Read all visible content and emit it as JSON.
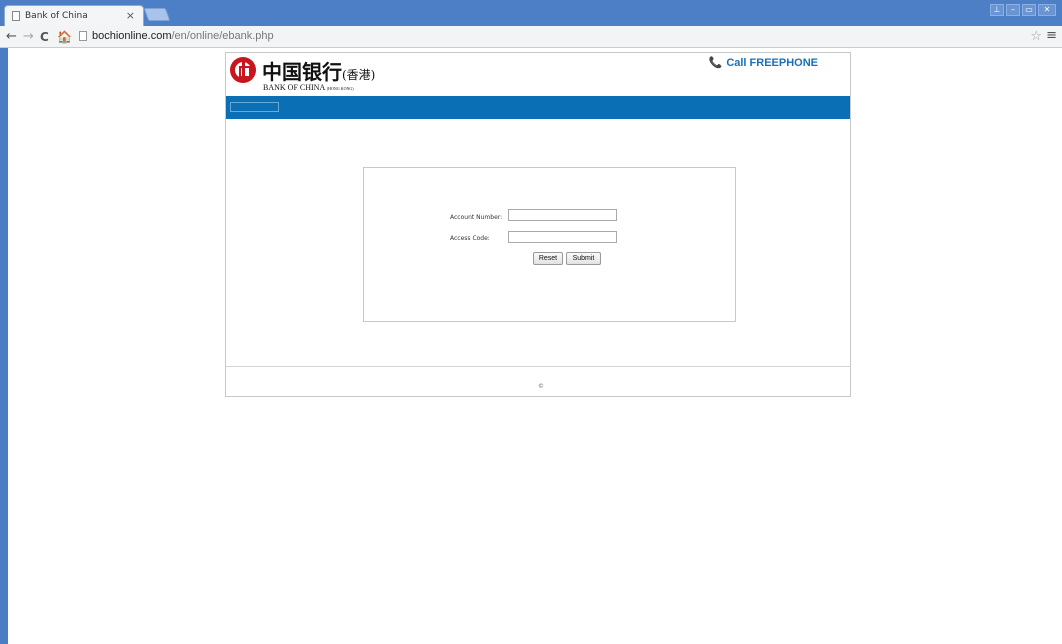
{
  "browser": {
    "tab_title": "Bank of China",
    "tab_close": "×",
    "url_domain": "bochionline.com",
    "url_path": "/en/online/ebank.php",
    "back": "←",
    "forward": "→",
    "reload": "C",
    "home": "🏠",
    "star": "☆",
    "menu": "≡",
    "win_user": "⊥",
    "win_min": "–",
    "win_max": "▭",
    "win_close": "✕"
  },
  "header": {
    "logo_cn": "中国银行",
    "logo_cn_sub": "(香港)",
    "logo_en": "BANK OF CHINA",
    "logo_en_sub": "(HONG KONG)",
    "phone_icon": "📞",
    "phone_text": "Call FREEPHONE"
  },
  "login": {
    "account_label": "Account Number:",
    "account_value": "",
    "access_label": "Access Code:",
    "access_value": "",
    "reset_label": "Reset",
    "submit_label": "Submit"
  },
  "footer": {
    "copyright": "©"
  },
  "colors": {
    "brand_blue": "#0a6fb4",
    "brand_red": "#c8161e",
    "phone_blue": "#1b6fb6"
  }
}
